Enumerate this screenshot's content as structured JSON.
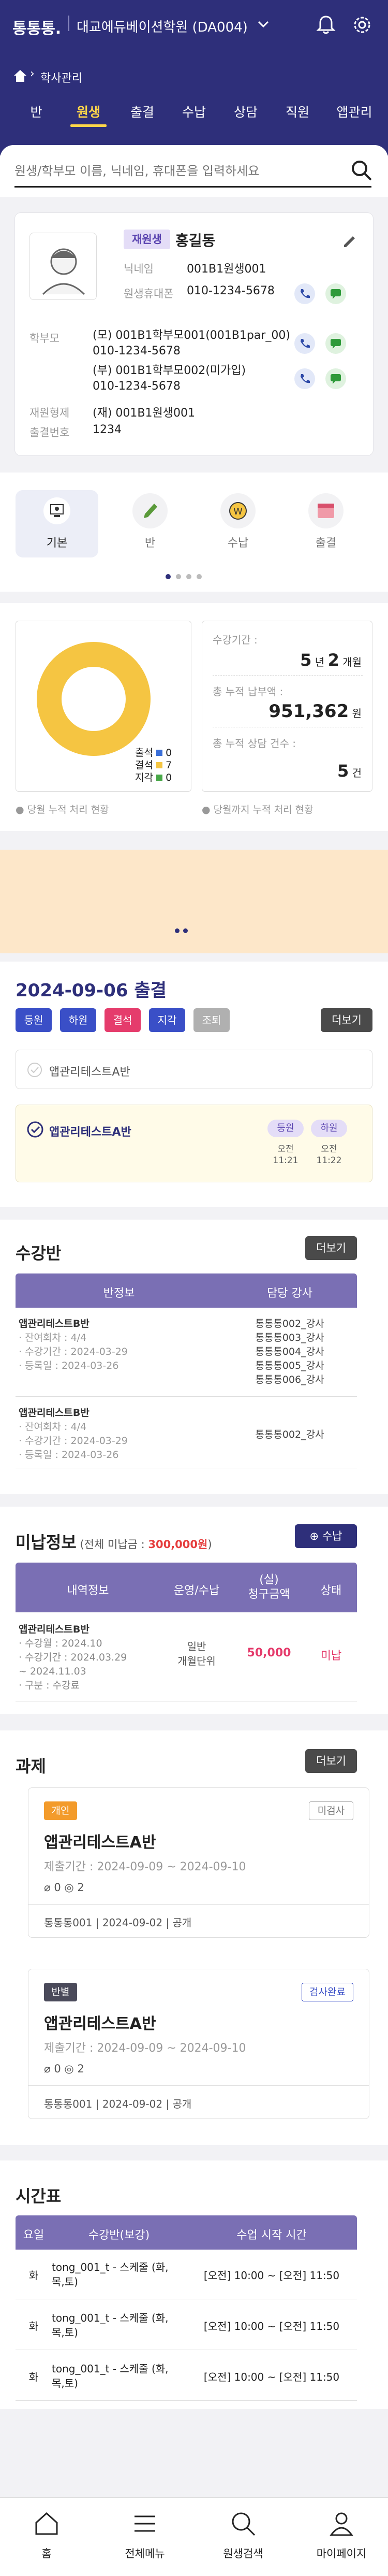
{
  "header": {
    "logo": "통통통.",
    "org": "대교에듀베이션학원 (DA004)",
    "breadcrumb": "학사관리"
  },
  "tabs": [
    "반",
    "원생",
    "출결",
    "수납",
    "상담",
    "직원",
    "앱관리"
  ],
  "search": {
    "placeholder": "원생/학부모 이름, 닉네임, 휴대폰을 입력하세요"
  },
  "student": {
    "status": "재원생",
    "name": "홍길동",
    "nick_label": "닉네임",
    "nick": "001B1원생001",
    "phone_label": "원생휴대폰",
    "phone": "010-1234-5678",
    "parent_label": "학부모",
    "parents": [
      {
        "name": "(모) 001B1학부모001(001B1par_00)",
        "phone": "010-1234-5678"
      },
      {
        "name": "(부) 001B1학부모002(미가입)",
        "phone": "010-1234-5678"
      }
    ],
    "class_label": "재원형제",
    "class": "(재) 001B1원생001",
    "att_label": "출결번호",
    "att": "1234"
  },
  "quick": [
    {
      "label": "기본"
    },
    {
      "label": "반"
    },
    {
      "label": "수납"
    },
    {
      "label": "출결"
    }
  ],
  "stats": {
    "legend": [
      {
        "label": "출석",
        "value": "0",
        "color": "#3a6fd8"
      },
      {
        "label": "결석",
        "value": "7",
        "color": "#f5c542"
      },
      {
        "label": "지각",
        "value": "0",
        "color": "#48a848"
      }
    ],
    "donut_values": {
      "attend": 0,
      "absent": 7,
      "late": 0
    },
    "caption_left": "당월 누적 처리 현황",
    "caption_right": "당월까지 누적 처리 현황",
    "period_label": "수강기간 :",
    "period_years": "5",
    "period_y_unit": "년",
    "period_months": "2",
    "period_m_unit": "개월",
    "paid_label": "총 누적 납부액 :",
    "paid": "951,362",
    "paid_unit": "원",
    "consult_label": "총 누적 상담 건수 :",
    "consult": "5",
    "consult_unit": "건"
  },
  "attendance": {
    "title": "2024-09-06 출결",
    "chips": [
      {
        "label": "등원",
        "color": "#3a4fc7"
      },
      {
        "label": "하원",
        "color": "#3a4fc7"
      },
      {
        "label": "결석",
        "color": "#e53c6c"
      },
      {
        "label": "지각",
        "color": "#3a4fc7"
      },
      {
        "label": "조퇴",
        "color": "#b0b0b0"
      }
    ],
    "more": "더보기",
    "row1": "앱관리테스트A반",
    "row2": "앱관리테스트A반",
    "in_label": "등원",
    "out_label": "하원",
    "in_time_a": "오전",
    "in_time_b": "11:21",
    "out_time_a": "오전",
    "out_time_b": "11:22"
  },
  "courses": {
    "title": "수강반",
    "more": "더보기",
    "head": [
      "반정보",
      "담당 강사"
    ],
    "rows": [
      {
        "name": "앱관리테스트B반",
        "l1": "· 잔여회차 : 4/4",
        "l2": "· 수강기간 : 2024-03-29",
        "l3": "· 등록일 : 2024-03-26",
        "teachers": [
          "통통통002_강사",
          "통통통003_강사",
          "통통통004_강사",
          "통통통005_강사",
          "통통통006_강사"
        ]
      },
      {
        "name": "앱관리테스트B반",
        "l1": "· 잔여회차 : 4/4",
        "l2": "· 수강기간 : 2024-03-29",
        "l3": "· 등록일 : 2024-03-26",
        "teachers": [
          "통통통002_강사"
        ]
      }
    ]
  },
  "unpaid": {
    "title": "미납정보",
    "sub_a": "(전체 미납금 : ",
    "sub_amount": "300,000원",
    "sub_b": ")",
    "button": "수납",
    "head": [
      "내역정보",
      "운영/수납",
      "(실)\n청구금액",
      "상태"
    ],
    "row": {
      "name": "앱관리테스트B반",
      "l1": "· 수강월 : 2024.10",
      "l2": "· 수강기간 : 2024.03.29",
      "l3": "~ 2024.11.03",
      "l4": "· 구분 : 수강료",
      "op1": "일반",
      "op2": "개월단위",
      "amount": "50,000",
      "status": "미납"
    }
  },
  "tasks": {
    "title": "과제",
    "more": "더보기",
    "items": [
      {
        "tag": "개인",
        "tag_color": "#f39b2b",
        "badge": "미검사",
        "name": "앱관리테스트A반",
        "period": "제출기간 : 2024-09-09 ~ 2024-09-10",
        "files": "0",
        "comments": "2",
        "foot": "통통통001 | 2024-09-02 | 공개"
      },
      {
        "tag": "반별",
        "tag_color": "#4a4a5a",
        "badge": "검사완료",
        "name": "앱관리테스트A반",
        "period": "제출기간 : 2024-09-09 ~ 2024-09-10",
        "files": "0",
        "comments": "2",
        "foot": "통통통001 | 2024-09-02 | 공개"
      }
    ]
  },
  "timetable": {
    "title": "시간표",
    "head": [
      "요일",
      "수강반(보강)",
      "수업 시작 시간"
    ],
    "rows": [
      {
        "day": "화",
        "cls": "tong_001_t - 스케줄 (화,목,토)",
        "time": "[오전] 10:00 ~ [오전] 11:50"
      },
      {
        "day": "화",
        "cls": "tong_001_t - 스케줄 (화,목,토)",
        "time": "[오전] 10:00 ~ [오전] 11:50"
      },
      {
        "day": "화",
        "cls": "tong_001_t - 스케줄 (화,목,토)",
        "time": "[오전] 10:00 ~ [오전] 11:50"
      }
    ]
  },
  "nav": [
    "홈",
    "전체메뉴",
    "원생검색",
    "마이페이지"
  ]
}
